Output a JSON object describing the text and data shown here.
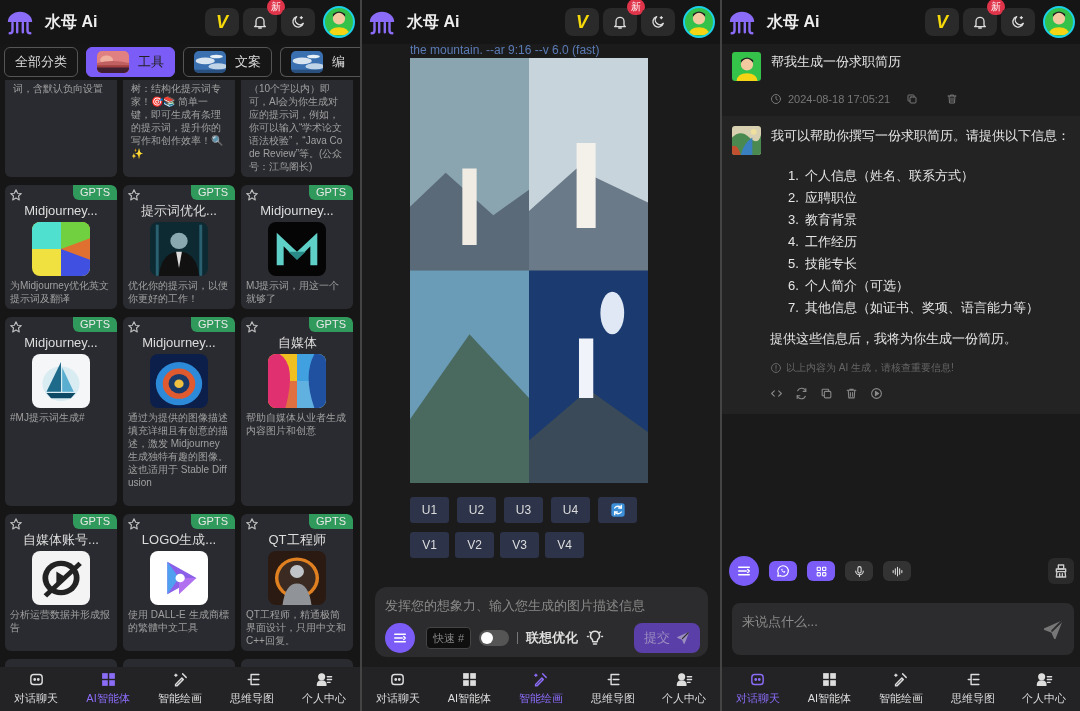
{
  "screens": [
    {
      "kind": "agents",
      "header": {
        "app_name": "水母 Ai",
        "vip_label": "V",
        "new_badge": "新"
      },
      "categories": [
        {
          "label": "全部分类",
          "kind": "plain",
          "selected": false
        },
        {
          "label": "工具",
          "kind": "picture",
          "selected": true
        },
        {
          "label": "文案",
          "kind": "picture",
          "selected": false
        },
        {
          "label": "编",
          "kind": "picture",
          "selected": false
        }
      ],
      "partial_cards": [
        {
          "description": "词，含默认负向设置"
        },
        {
          "description": "树：结构化提示词专家！🎯📚 简单一键，即可生成有条理的提示词，提升你的写作和创作效率！🔍✨"
        },
        {
          "description": "（10个字以内）即可，AI会为你生成对应的提示词，例如，你可以输入“学术论文语法校验”，“Java Code Review”等。(公众号：江鸟阁长)"
        }
      ],
      "agents": [
        {
          "title": "Midjourney...",
          "tag": "GPTS",
          "favorite": false,
          "description": "为Midjourney优化英文提示词及翻译"
        },
        {
          "title": "提示词优化...",
          "tag": "GPTS",
          "favorite": false,
          "description": "优化你的提示词，以便你更好的工作！"
        },
        {
          "title": "Midjourney...",
          "tag": "GPTS",
          "favorite": false,
          "description": "MJ提示词，用这一个就够了"
        },
        {
          "title": "Midjourney...",
          "tag": "GPTS",
          "favorite": false,
          "description": "#MJ提示词生成#"
        },
        {
          "title": "Midjourney...",
          "tag": "GPTS",
          "favorite": false,
          "description": "通过为提供的图像描述填充详细且有创意的描述，激发 Midjourney 生成独特有趣的图像。这也适用于 Stable Diffusion"
        },
        {
          "title": "自媒体",
          "tag": "GPTS",
          "favorite": false,
          "description": "帮助自媒体从业者生成内容图片和创意"
        },
        {
          "title": "自媒体账号...",
          "tag": "GPTS",
          "favorite": false,
          "description": "分析运营数据并形成报告"
        },
        {
          "title": "LOGO生成...",
          "tag": "GPTS",
          "favorite": false,
          "description": "使用 DALL-E 生成商標的繁體中文工具"
        },
        {
          "title": "QT工程师",
          "tag": "GPTS",
          "favorite": false,
          "description": "QT工程师，精通极简界面设计，只用中文和C++回复。"
        }
      ],
      "nav": [
        {
          "label": "对话聊天",
          "kind": "chat",
          "selected": false
        },
        {
          "label": "AI智能体",
          "kind": "agents",
          "selected": true
        },
        {
          "label": "智能绘画",
          "kind": "draw",
          "selected": false
        },
        {
          "label": "思维导图",
          "kind": "mindmap",
          "selected": false
        },
        {
          "label": "个人中心",
          "kind": "user",
          "selected": false
        }
      ]
    },
    {
      "kind": "drawing",
      "header": {
        "app_name": "水母 Ai",
        "vip_label": "V",
        "new_badge": "新"
      },
      "prompt_tail": "the mountain. --ar 9:16 --v 6.0 (fast)",
      "upscale_buttons": [
        "U1",
        "U2",
        "U3",
        "U4"
      ],
      "variation_buttons": [
        "V1",
        "V2",
        "V3",
        "V4"
      ],
      "composer": {
        "placeholder": "发挥您的想象力、输入您生成的图片描述信息",
        "mode": "快速",
        "mode_hint": "#",
        "optimize_on": false,
        "optimize_label": "联想优化",
        "submit": "提交"
      },
      "nav": [
        {
          "label": "对话聊天",
          "kind": "chat",
          "selected": false
        },
        {
          "label": "AI智能体",
          "kind": "agents",
          "selected": false
        },
        {
          "label": "智能绘画",
          "kind": "draw",
          "selected": true
        },
        {
          "label": "思维导图",
          "kind": "mindmap",
          "selected": false
        },
        {
          "label": "个人中心",
          "kind": "user",
          "selected": false
        }
      ]
    },
    {
      "kind": "chat",
      "header": {
        "app_name": "水母 Ai",
        "vip_label": "V",
        "new_badge": "新"
      },
      "messages": [
        {
          "kind": "user",
          "text": "帮我生成一份求职简历",
          "time": "2024-08-18 17:05:21"
        },
        {
          "kind": "assistant",
          "intro": "我可以帮助你撰写一份求职简历。请提供以下信息：",
          "items": [
            {
              "number": "1.",
              "text": "个人信息（姓名、联系方式）"
            },
            {
              "number": "2.",
              "text": "应聘职位"
            },
            {
              "number": "3.",
              "text": "教育背景"
            },
            {
              "number": "4.",
              "text": "工作经历"
            },
            {
              "number": "5.",
              "text": "技能专长"
            },
            {
              "number": "6.",
              "text": "个人简介（可选）"
            },
            {
              "number": "7.",
              "text": "其他信息（如证书、奖项、语言能力等）"
            }
          ],
          "outro": "提供这些信息后，我将为你生成一份简历。",
          "note": "以上内容为 AI 生成，请核查重要信息!"
        }
      ],
      "composer": {
        "placeholder": "来说点什么..."
      },
      "nav": [
        {
          "label": "对话聊天",
          "kind": "chat",
          "selected": true
        },
        {
          "label": "AI智能体",
          "kind": "agents",
          "selected": false
        },
        {
          "label": "智能绘画",
          "kind": "draw",
          "selected": false
        },
        {
          "label": "思维导图",
          "kind": "mindmap",
          "selected": false
        },
        {
          "label": "个人中心",
          "kind": "user",
          "selected": false
        }
      ]
    }
  ]
}
